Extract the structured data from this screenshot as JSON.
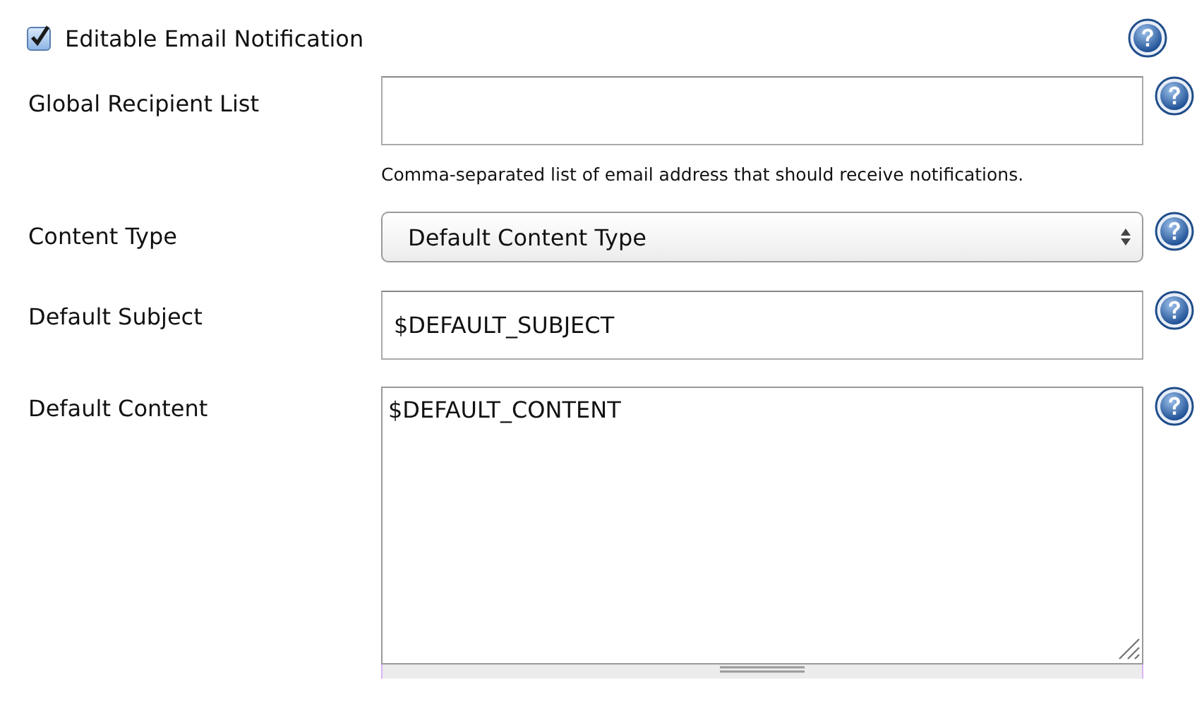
{
  "checkbox": {
    "label": "Editable Email Notification",
    "checked": true
  },
  "fields": [
    {
      "kind": "text",
      "label": "Global Recipient List",
      "help_text": "Comma-separated list of email address that should receive notifications."
    },
    {
      "kind": "select",
      "label": "Content Type",
      "value": "Default Content Type"
    },
    {
      "kind": "text",
      "label": "Default Subject",
      "value": "$DEFAULT_SUBJECT"
    },
    {
      "kind": "textarea",
      "label": "Default Content",
      "value": "$DEFAULT_CONTENT"
    }
  ]
}
